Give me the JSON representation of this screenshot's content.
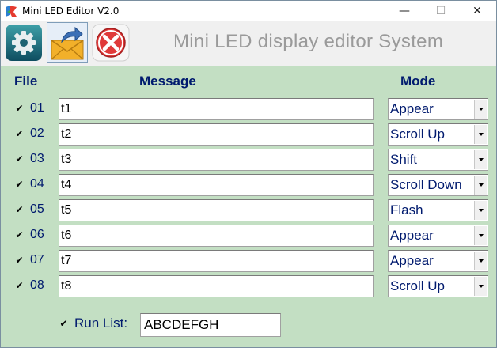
{
  "window": {
    "title": "Mini LED Editor V2.0",
    "minimize": "—",
    "maximize": "☐",
    "close": "✕"
  },
  "toolbar": {
    "banner": "Mini LED display editor System",
    "icons": [
      "gear-icon",
      "send-envelope-icon",
      "exit-icon"
    ]
  },
  "headers": {
    "file": "File",
    "message": "Message",
    "mode": "Mode"
  },
  "check_glyph": "✔",
  "rows": [
    {
      "num": "01",
      "message": "t1",
      "mode": "Appear",
      "checked": true
    },
    {
      "num": "02",
      "message": "t2",
      "mode": "Scroll Up",
      "checked": true
    },
    {
      "num": "03",
      "message": "t3",
      "mode": "Shift",
      "checked": true
    },
    {
      "num": "04",
      "message": "t4",
      "mode": "Scroll Down",
      "checked": true
    },
    {
      "num": "05",
      "message": "t5",
      "mode": "Flash",
      "checked": true
    },
    {
      "num": "06",
      "message": "t6",
      "mode": "Appear",
      "checked": true
    },
    {
      "num": "07",
      "message": "t7",
      "mode": "Appear",
      "checked": true
    },
    {
      "num": "08",
      "message": "t8",
      "mode": "Scroll Up",
      "checked": true
    }
  ],
  "run_list": {
    "label": "Run List:",
    "value": "ABCDEFGH",
    "checked": true
  },
  "colors": {
    "background": "#c3dfc3",
    "label_text": "#001a6e",
    "banner_text": "#9a9a9a"
  }
}
